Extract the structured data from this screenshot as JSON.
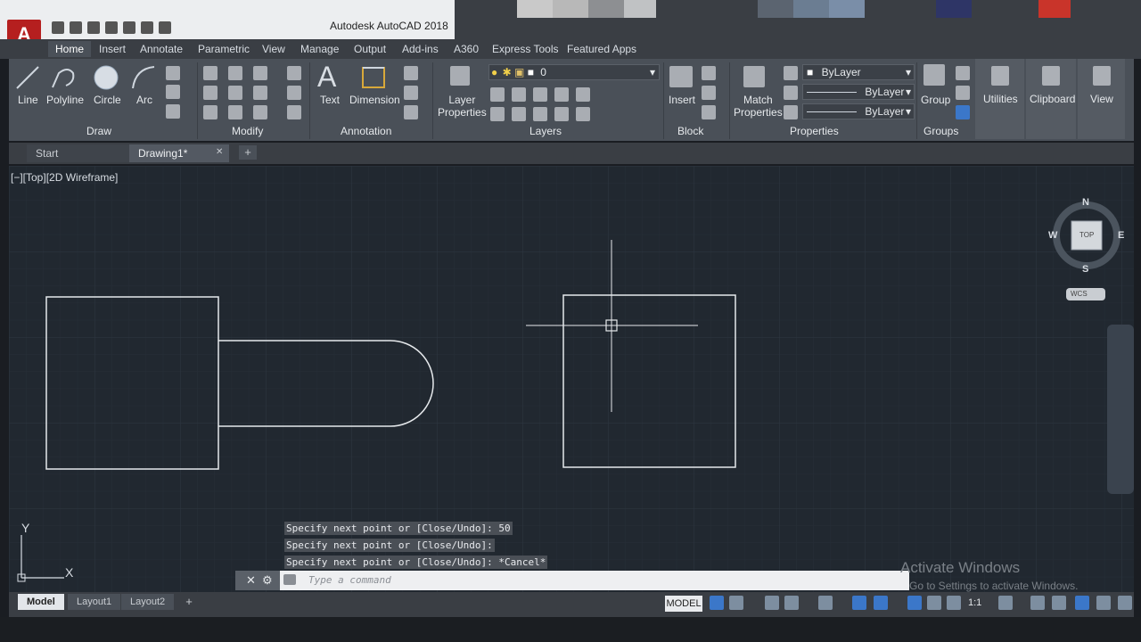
{
  "window": {
    "title": "Autodesk AutoCAD 2018",
    "app_button": "A"
  },
  "menu_tabs": [
    "Home",
    "Insert",
    "Annotate",
    "Parametric",
    "View",
    "Manage",
    "Output",
    "Add-ins",
    "A360",
    "Express Tools",
    "Featured Apps"
  ],
  "ribbon": {
    "draw": {
      "group": "Draw",
      "line": "Line",
      "polyline": "Polyline",
      "circle": "Circle",
      "arc": "Arc"
    },
    "modify": {
      "group": "Modify"
    },
    "annotation": {
      "group": "Annotation",
      "text": "Text",
      "dimension": "Dimension"
    },
    "layers": {
      "group": "Layers",
      "layer_properties": "Layer\nProperties",
      "layer_value": "0"
    },
    "block": {
      "group": "Block",
      "insert": "Insert"
    },
    "properties": {
      "group": "Properties",
      "match": "Match\nProperties",
      "color": "ByLayer",
      "linetype": "ByLayer",
      "lineweight": "ByLayer"
    },
    "groups": {
      "group": "Groups",
      "group_btn": "Group"
    },
    "utilities": "Utilities",
    "clipboard": "Clipboard",
    "view": "View"
  },
  "file_tabs": {
    "start": "Start",
    "drawing": "Drawing1*",
    "close": "✕",
    "add": "+"
  },
  "viewport": {
    "label": "[−][Top][2D Wireframe]",
    "viewcube": {
      "n": "N",
      "s": "S",
      "e": "E",
      "w": "W",
      "top": "TOP",
      "wcs": "WCS"
    },
    "ucs_x": "X",
    "ucs_y": "Y"
  },
  "command": {
    "history": [
      "Specify next point or [Close/Undo]: 50",
      "Specify next point or [Close/Undo]:",
      "Specify next point or [Close/Undo]: *Cancel*"
    ],
    "placeholder": "Type a command"
  },
  "watermark": {
    "line1": "Activate Windows",
    "line2": "Go to Settings to activate Windows."
  },
  "layout_tabs": [
    "Model",
    "Layout1",
    "Layout2"
  ],
  "status": {
    "model": "MODEL",
    "scale": "1:1"
  }
}
